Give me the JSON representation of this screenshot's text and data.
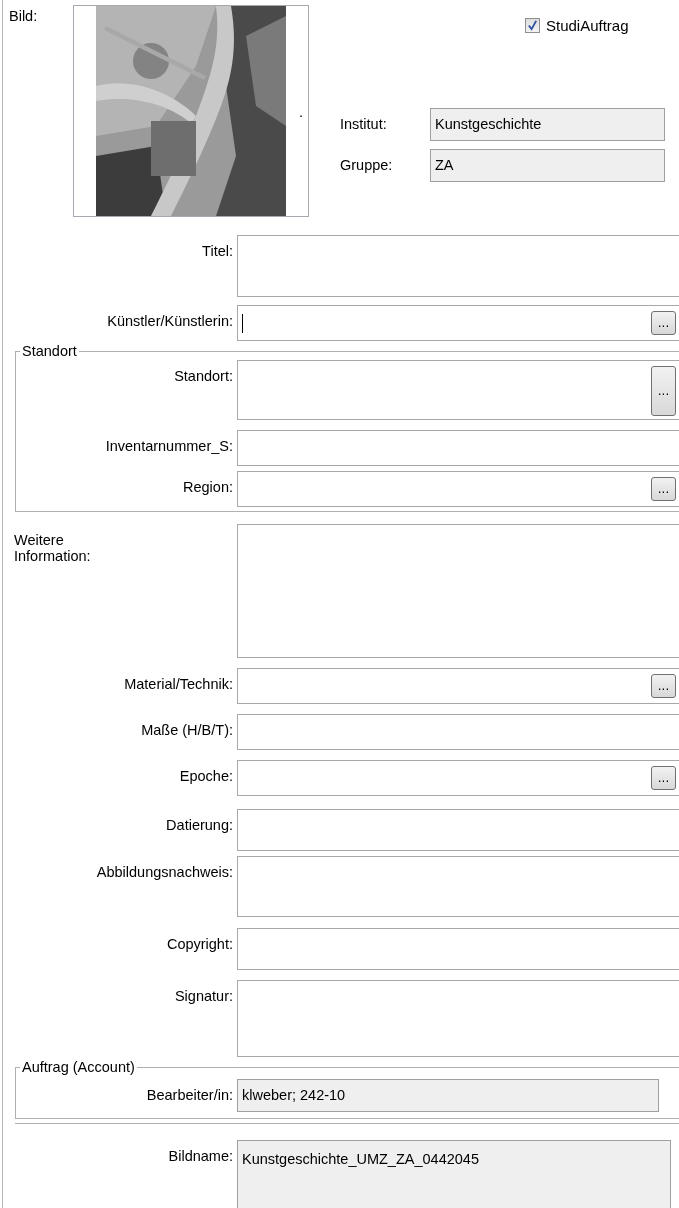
{
  "image_label": "Bild:",
  "image_mark": ".",
  "studi_auftrag": {
    "label": "StudiAuftrag",
    "checked": true
  },
  "header_fields": [
    {
      "label": "Institut:",
      "value": "Kunstgeschichte"
    },
    {
      "label": "Gruppe:",
      "value": "ZA"
    }
  ],
  "sections": [
    {
      "kind": "field",
      "label": "Titel:",
      "browse": false,
      "readonly": false,
      "focused": false
    },
    {
      "kind": "field",
      "label": "Künstler/Künstlerin:",
      "browse": true,
      "button": "...",
      "readonly": false,
      "focused": true
    },
    {
      "kind": "group",
      "title": "Standort",
      "fields": [
        {
          "label": "Standort:",
          "browse": true,
          "button": "...",
          "readonly": false,
          "focused": false
        },
        {
          "label": "Inventarnummer_S:",
          "browse": false,
          "readonly": false,
          "focused": false
        },
        {
          "label": "Region:",
          "browse": true,
          "button": "...",
          "readonly": false,
          "focused": false
        }
      ]
    },
    {
      "kind": "note",
      "label": "Weitere Information:",
      "browse": false,
      "readonly": false,
      "focused": false
    },
    {
      "kind": "field",
      "label": "Material/Technik:",
      "browse": true,
      "button": "...",
      "readonly": false,
      "focused": false
    },
    {
      "kind": "field",
      "label": "Maße (H/B/T):",
      "browse": false,
      "readonly": false,
      "focused": false
    },
    {
      "kind": "field",
      "label": "Epoche:",
      "browse": true,
      "button": "...",
      "readonly": false,
      "focused": false
    },
    {
      "kind": "field",
      "label": "Datierung:",
      "browse": false,
      "readonly": false,
      "focused": false
    },
    {
      "kind": "field",
      "label": "Abbildungsnachweis:",
      "browse": false,
      "readonly": false,
      "focused": false
    },
    {
      "kind": "field",
      "label": "Copyright:",
      "browse": false,
      "readonly": false,
      "focused": false
    },
    {
      "kind": "field",
      "label": "Signatur:",
      "browse": false,
      "readonly": false,
      "focused": false
    },
    {
      "kind": "group",
      "title": "Auftrag (Account)",
      "fields": [
        {
          "label": "Bearbeiter/in:",
          "value": "klweber; 242-10",
          "browse": false,
          "readonly": true,
          "focused": false
        }
      ]
    },
    {
      "kind": "rule"
    },
    {
      "kind": "field",
      "label": "Bildname:",
      "value": "Kunstgeschichte_UMZ_ZA_0442045",
      "browse": false,
      "readonly": true,
      "focused": false
    }
  ]
}
